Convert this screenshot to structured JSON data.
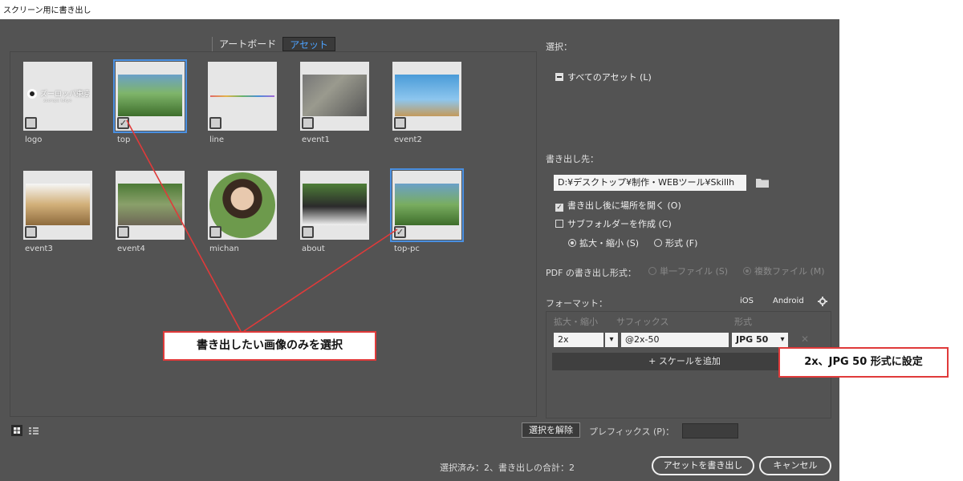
{
  "window": {
    "title": "スクリーン用に書き出し"
  },
  "tabs": [
    {
      "label": "アートボード",
      "active": false
    },
    {
      "label": "アセット",
      "active": true
    }
  ],
  "assets": [
    {
      "name": "logo",
      "selected": false,
      "logo_text": "ズーロッパ東京",
      "logo_sub": "zooropa tokyo"
    },
    {
      "name": "top",
      "selected": true
    },
    {
      "name": "line",
      "selected": false
    },
    {
      "name": "event1",
      "selected": false
    },
    {
      "name": "event2",
      "selected": false
    },
    {
      "name": "event3",
      "selected": false
    },
    {
      "name": "event4",
      "selected": false
    },
    {
      "name": "michan",
      "selected": false
    },
    {
      "name": "about",
      "selected": false
    },
    {
      "name": "top-pc",
      "selected": true
    }
  ],
  "checkmark": "✓",
  "right": {
    "select_label": "選択：",
    "all_assets": "すべてのアセット (L)",
    "dest_label": "書き出し先：",
    "dest_path": "D:¥デスクトップ¥制作・WEBツール¥Skillh",
    "open_after": "書き出し後に場所を開く (O)",
    "create_subfolder": "サブフォルダーを作成 (C)",
    "subfolder_scale": "拡大・縮小 (S)",
    "subfolder_format": "形式 (F)",
    "pdf_label": "PDF の書き出し形式：",
    "pdf_single": "単一ファイル (S)",
    "pdf_multi": "複数ファイル (M)",
    "format_label": "フォーマット：",
    "ios": "iOS",
    "android": "Android",
    "col_scale": "拡大・縮小",
    "col_suffix": "サフィックス",
    "col_format": "形式",
    "scale_value": "2x",
    "suffix_value": "@2x-50",
    "format_value": "JPG 50",
    "add_scale": "+ スケールを追加"
  },
  "bottom": {
    "deselect": "選択を解除",
    "prefix_label": "プレフィックス (P)：",
    "status": "選択済み：2、書き出しの合計：2",
    "export": "アセットを書き出し",
    "cancel": "キャンセル"
  },
  "annotations": {
    "select_note": "書き出したい画像のみを選択",
    "format_note": "2x、JPG 50 形式に設定",
    "color": "#e03a3a"
  }
}
